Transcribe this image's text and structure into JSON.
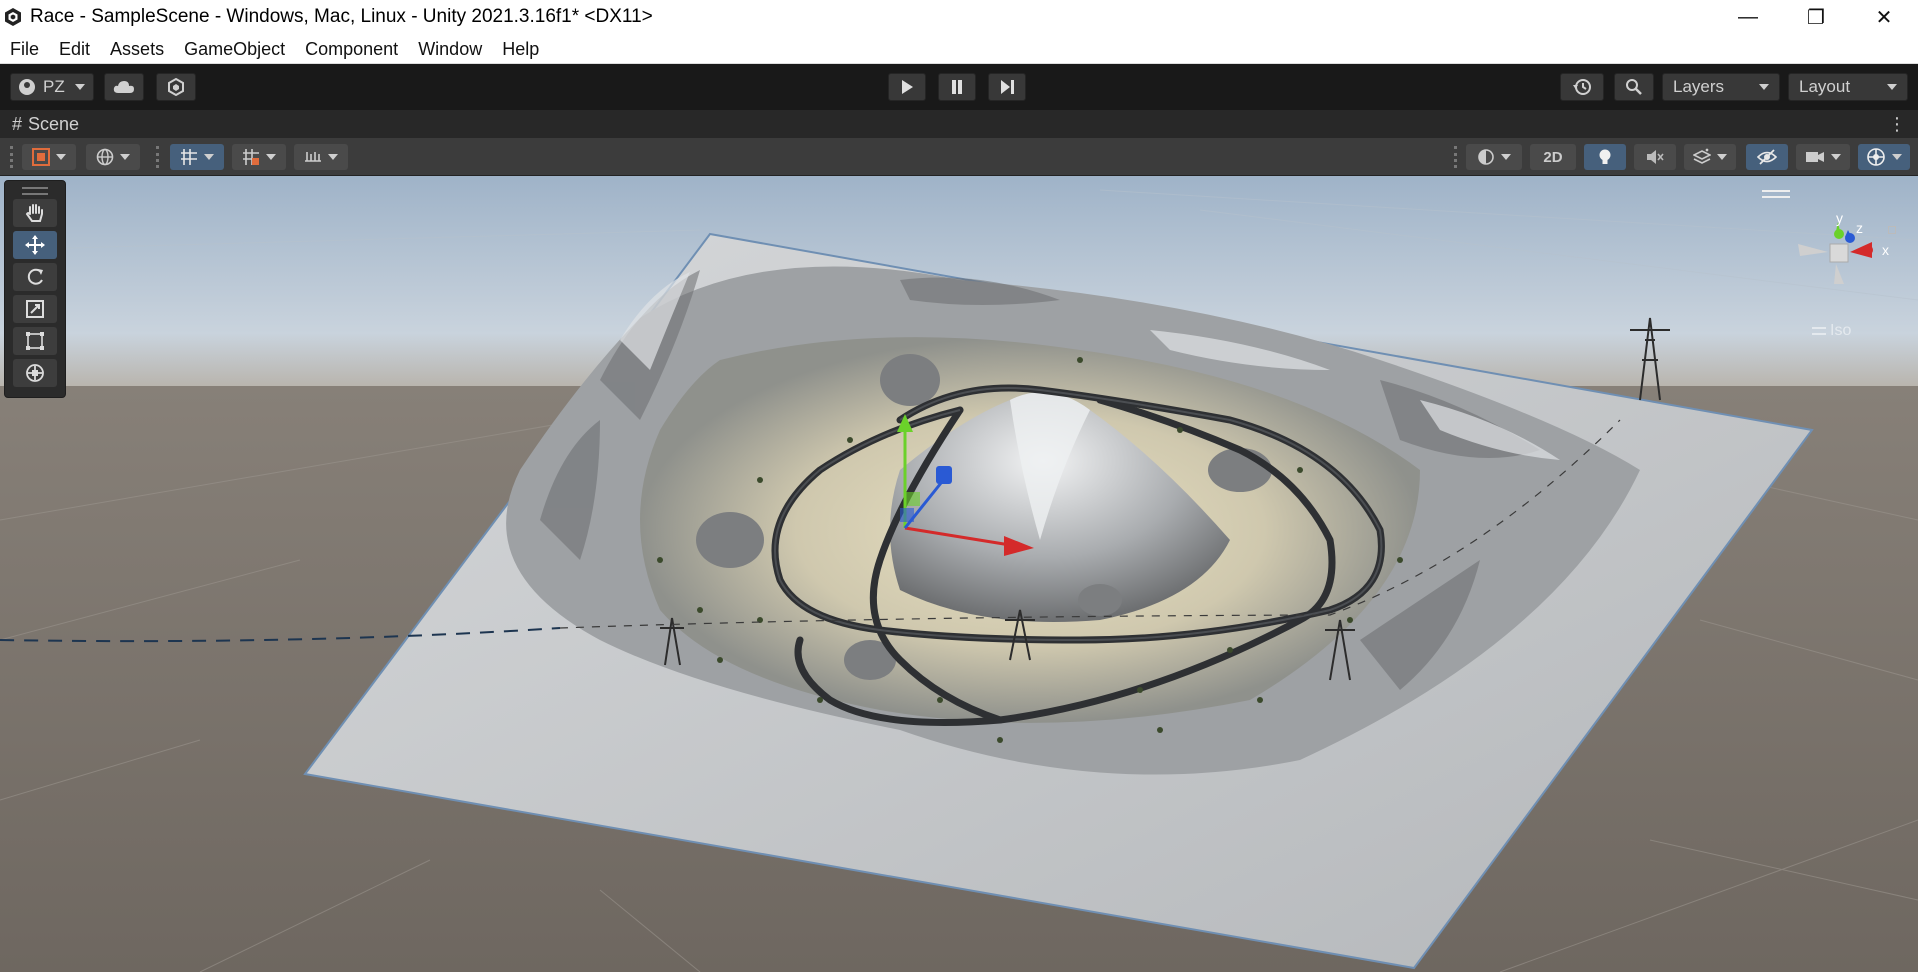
{
  "window": {
    "title": "Race - SampleScene - Windows, Mac, Linux - Unity 2021.3.16f1* <DX11>",
    "controls": {
      "minimize": "—",
      "restore": "❐",
      "close": "✕"
    }
  },
  "menu": [
    "File",
    "Edit",
    "Assets",
    "GameObject",
    "Component",
    "Window",
    "Help"
  ],
  "toolbar": {
    "account_label": "PZ",
    "layers_label": "Layers",
    "layout_label": "Layout",
    "play_icon": "play-icon",
    "pause_icon": "pause-icon",
    "step_icon": "step-icon"
  },
  "scene_tab": {
    "label": "Scene",
    "icon": "hash-icon"
  },
  "scene_toolbar": {
    "mode_2d_label": "2D"
  },
  "tools": [
    "hand-tool",
    "move-tool",
    "rotate-tool",
    "scale-tool",
    "rect-tool",
    "transform-tool"
  ],
  "gizmo": {
    "y_label": "y",
    "x_label": "x",
    "z_label": "z",
    "projection_label": "Iso"
  },
  "colors": {
    "accent": "#46607c",
    "x_axis": "#d42a2a",
    "y_axis": "#6bd12a",
    "z_axis": "#2a5ad4"
  }
}
